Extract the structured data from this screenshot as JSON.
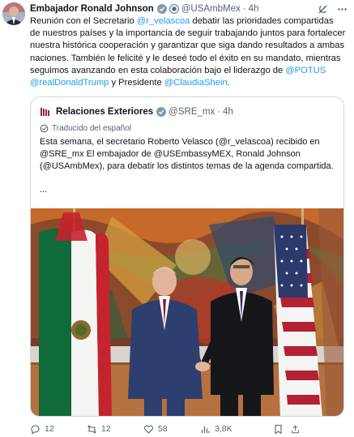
{
  "author": {
    "name": "Embajador Ronald Johnson",
    "handle": "@USAmbMex",
    "separator": "·",
    "time": "4h"
  },
  "post": {
    "segments": [
      {
        "text": "Reunión con el Secretario ",
        "mention": false
      },
      {
        "text": "@r_velascoa",
        "mention": true
      },
      {
        "text": " debatir las prioridades compartidas de nuestros países y la importancia de seguir trabajando juntos para fortalecer nuestra histórica cooperación y garantizar que siga dando resultados a ambas naciones. También le felicité y le deseé todo el éxito en su mandato, mientras seguimos avanzando en esta colaboración bajo el liderazgo de ",
        "mention": false
      },
      {
        "text": "@POTUS",
        "mention": true
      },
      {
        "text": " ",
        "mention": false
      },
      {
        "text": "@realDonaldTrump",
        "mention": true
      },
      {
        "text": " y Presidente ",
        "mention": false
      },
      {
        "text": "@ClaudiaShein",
        "mention": true
      },
      {
        "text": ".",
        "mention": false
      }
    ]
  },
  "quote": {
    "name": "Relaciones Exteriores",
    "handle": "@SRE_mx",
    "separator": "·",
    "time": "4h",
    "translated_label": "Traducido del español",
    "text": "Esta semana, el secretario Roberto Velasco (@r_velascoa) recibido en @SRE_mx El embajador de @USEmbassyMEX, Ronald Johnson (@USAmbMex), para debatir los distintos temas de la agenda compartida.",
    "ellipsis": "..."
  },
  "actions": {
    "replies": "12",
    "reposts": "12",
    "likes": "58",
    "views": "3,8K"
  },
  "colors": {
    "accent": "#1d9bf0",
    "secondary_text": "#536471",
    "border": "#cfd9de",
    "verified_gray": "#829aab",
    "verified_gold": "#e2b719"
  },
  "icons": [
    "grok-icon",
    "more-icon",
    "gray-checkmark-badge",
    "gold-checkmark-badge",
    "translate-icon",
    "reply-icon",
    "repost-icon",
    "like-icon",
    "views-icon",
    "bookmark-icon",
    "share-icon"
  ]
}
